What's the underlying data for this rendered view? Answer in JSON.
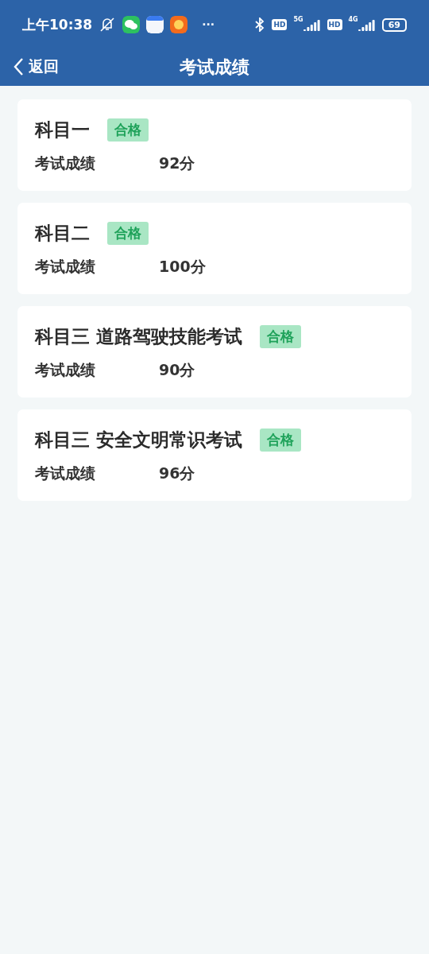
{
  "status_bar": {
    "time": "上午10:38",
    "more": "···",
    "hd_1": "HD",
    "network_1": "5G",
    "hd_2": "HD",
    "network_2": "4G",
    "battery": "69"
  },
  "nav": {
    "back": "返回",
    "title": "考试成绩"
  },
  "results": [
    {
      "subject": "科目一",
      "status": "合格",
      "passed": true,
      "label": "考试成绩",
      "score": "92分"
    },
    {
      "subject": "科目二",
      "status": "合格",
      "passed": true,
      "label": "考试成绩",
      "score": "100分"
    },
    {
      "subject": "科目三 道路驾驶技能考试",
      "status": "合格",
      "passed": true,
      "label": "考试成绩",
      "score": "90分"
    },
    {
      "subject": "科目三 安全文明常识考试",
      "status": "合格",
      "passed": true,
      "label": "考试成绩",
      "score": "96分"
    }
  ]
}
